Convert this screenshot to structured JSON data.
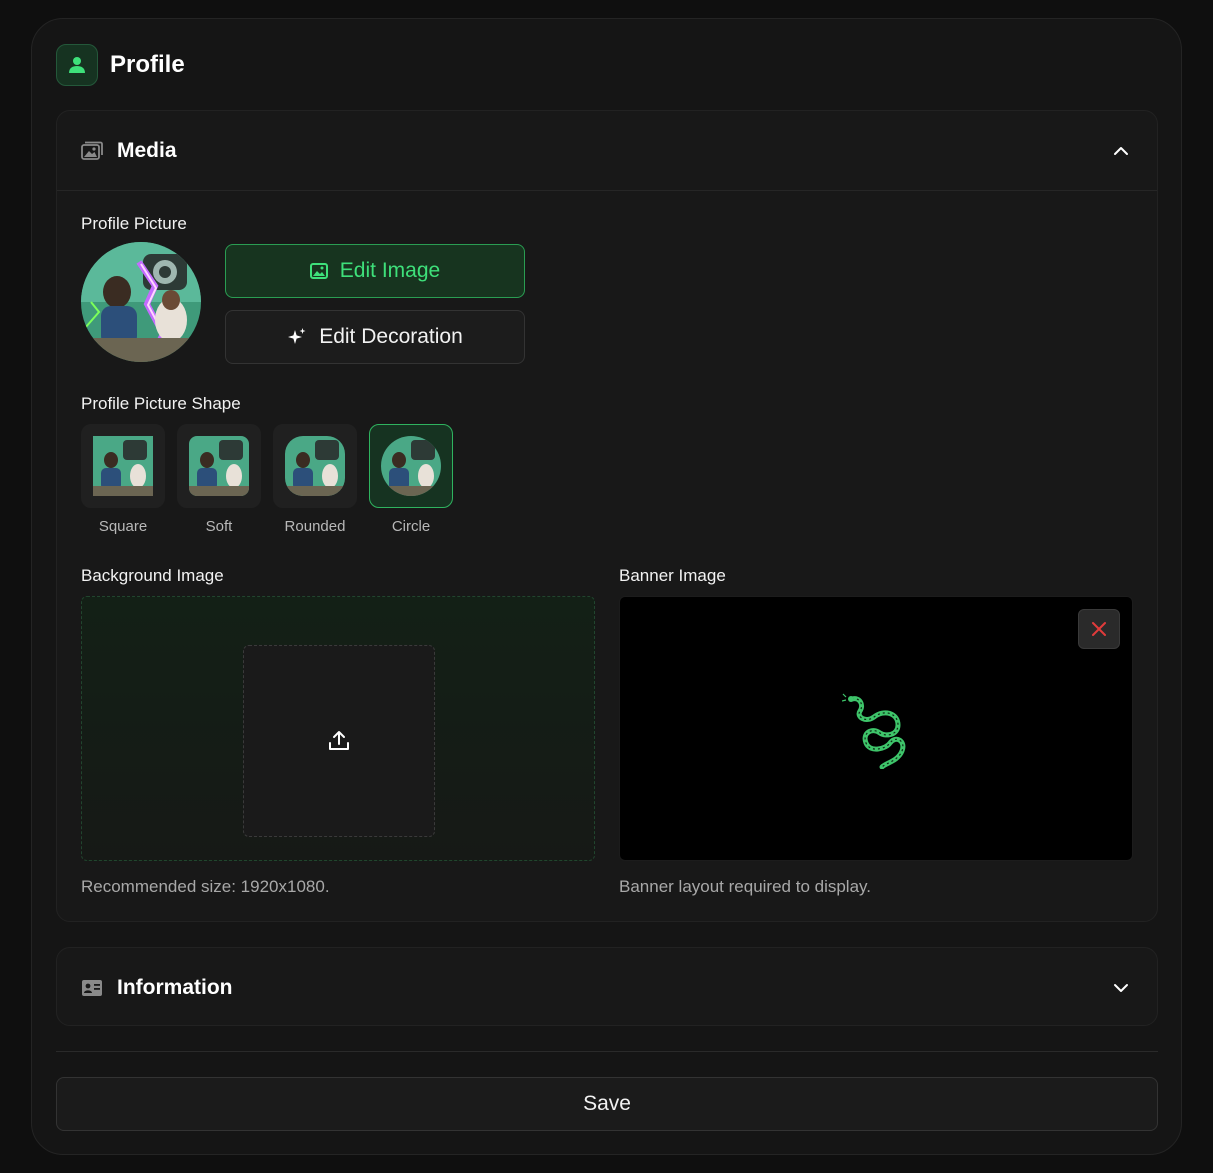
{
  "header": {
    "title": "Profile",
    "icon": "user-icon",
    "accent": "#3ee07a"
  },
  "media": {
    "title": "Media",
    "icon": "images-icon",
    "expanded": true,
    "profile_picture_label": "Profile Picture",
    "edit_image_label": "Edit Image",
    "edit_decoration_label": "Edit Decoration",
    "shape_label": "Profile Picture Shape",
    "shapes": [
      {
        "name": "Square",
        "selected": false
      },
      {
        "name": "Soft",
        "selected": false
      },
      {
        "name": "Rounded",
        "selected": false
      },
      {
        "name": "Circle",
        "selected": true
      }
    ],
    "background_label": "Background Image",
    "background_hint": "Recommended size: 1920x1080.",
    "banner_label": "Banner Image",
    "banner_hint": "Banner layout required to display."
  },
  "information": {
    "title": "Information",
    "icon": "id-card-icon",
    "expanded": false
  },
  "save_label": "Save"
}
